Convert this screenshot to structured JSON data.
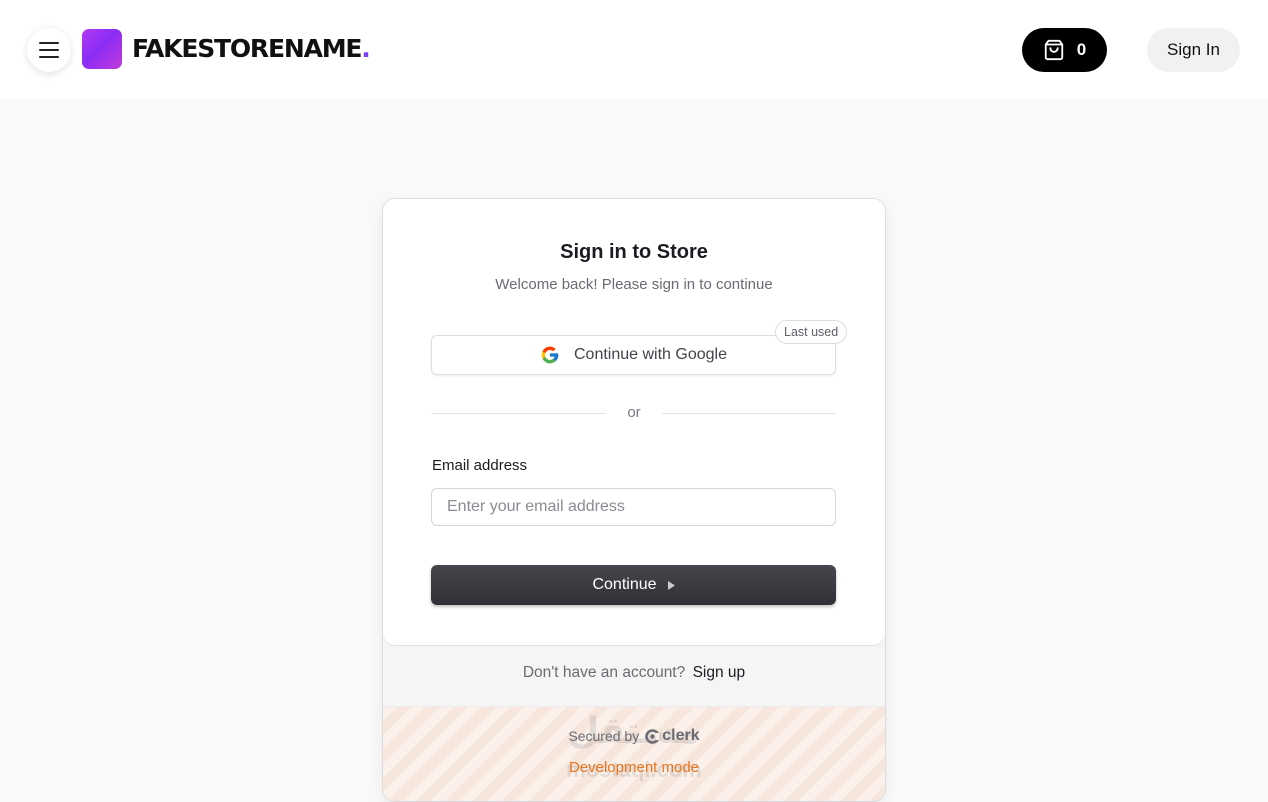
{
  "header": {
    "logo_text": "FAKESTORENAME",
    "logo_dot": ".",
    "cart_count": "0",
    "signin_label": "Sign In"
  },
  "signin_card": {
    "title": "Sign in to Store",
    "subtitle": "Welcome back! Please sign in to continue",
    "google_label": "Continue with Google",
    "last_used_badge": "Last used",
    "divider_text": "or",
    "email_label": "Email address",
    "email_placeholder": "Enter your email address",
    "email_value": "",
    "continue_label": "Continue",
    "signup_prompt": "Don't have an account?",
    "signup_link": "Sign up",
    "secured_by": "Secured by",
    "clerk_brand": "clerk",
    "dev_mode": "Development mode"
  },
  "watermark": {
    "arabic": "مستقل",
    "latin": "mostaql.com"
  },
  "icons": {
    "menu": "hamburger-menu-icon",
    "cart": "shopping-bag-icon",
    "google": "google-g-icon",
    "continue_arrow": "caret-right-icon",
    "clerk": "clerk-logo-icon"
  },
  "colors": {
    "brand_gradient_start": "#b43cf0",
    "brand_gradient_end": "#8a2cf5",
    "logo_dot": "#7b3ff2",
    "cart_bg": "#000000",
    "continue_bg": "#3a3a40",
    "dev_mode": "#e8741e"
  }
}
